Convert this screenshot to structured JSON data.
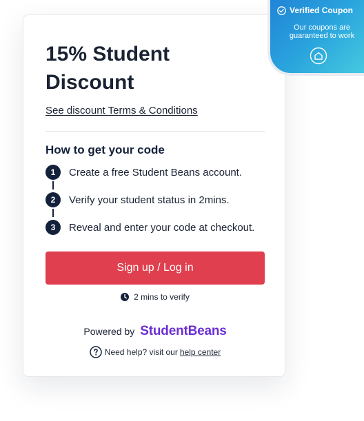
{
  "offer": {
    "title": "15% Student Discount",
    "terms_link": "See discount Terms & Conditions"
  },
  "howto": {
    "heading": "How to get your code",
    "steps": [
      {
        "number": "1",
        "text": "Create a free Student Beans account."
      },
      {
        "number": "2",
        "text": "Verify your student status in 2mins."
      },
      {
        "number": "3",
        "text": "Reveal and enter your code at checkout."
      }
    ]
  },
  "cta": {
    "signup_label": "Sign up / Log in",
    "verify_time": "2 mins to verify"
  },
  "footer": {
    "powered_by": "Powered by",
    "brand": "StudentBeans",
    "help_prefix": "Need help? visit our",
    "help_link": "help center"
  },
  "badge": {
    "title": "Verified Coupon",
    "text": "Our coupons are guaranteed to work"
  },
  "icons": {
    "clock": "clock-icon",
    "help": "question-circle-icon",
    "check": "check-circle-icon",
    "home": "home-icon"
  },
  "colors": {
    "primary_navy": "#13213b",
    "cta_red": "#df3f4e",
    "brand_purple": "#6b2fd3",
    "badge_blue": "#2aa4dd"
  }
}
